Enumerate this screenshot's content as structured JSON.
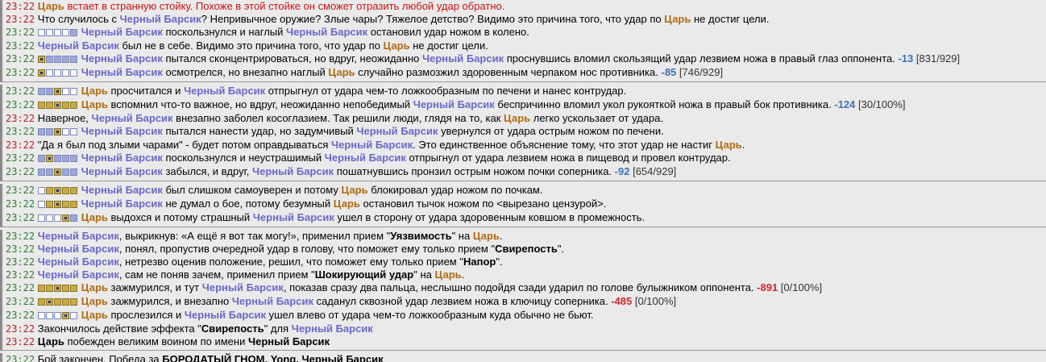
{
  "names": {
    "barsik": "Черный Барсик",
    "tsar": "Царь"
  },
  "time": "23:22",
  "lines": [
    {
      "group": 1,
      "time_red": true,
      "red": true,
      "parts": [
        [
          "c",
          "Царь"
        ],
        [
          "t",
          " встает в странную стойку. Похоже в этой стойке он сможет отразить любой удар обратно."
        ]
      ]
    },
    {
      "group": 1,
      "time_red": true,
      "parts": [
        [
          "t",
          "Что случилось с "
        ],
        [
          "b",
          "Черный Барсик"
        ],
        [
          "t",
          "? Непривычное оружие? Злые чары? Тяжелое детство? Видимо это причина того, что удар по "
        ],
        [
          "c",
          "Царь"
        ],
        [
          "t",
          " не достиг цели."
        ]
      ]
    },
    {
      "group": 1,
      "zones": "wwwwf",
      "parts": [
        [
          "b",
          "Черный Барсик"
        ],
        [
          "t",
          " поскользнулся и наглый "
        ],
        [
          "b",
          "Черный Барсик"
        ],
        [
          "t",
          " остановил удар ножом в колено."
        ]
      ]
    },
    {
      "group": 1,
      "parts": [
        [
          "b",
          "Черный Барсик"
        ],
        [
          "t",
          " был не в себе. Видимо это причина того, что удар по "
        ],
        [
          "c",
          "Царь"
        ],
        [
          "t",
          " не достиг цели."
        ]
      ]
    },
    {
      "group": 1,
      "wrap": true,
      "zones": "xffff",
      "parts": [
        [
          "b",
          "Черный Барсик"
        ],
        [
          "t",
          " пытался сконцентрироваться, но вдруг, неожиданно "
        ],
        [
          "b",
          "Черный Барсик"
        ],
        [
          "t",
          " проснувшись вломил скользящий удар лезвием ножа в правый глаз оппонента. "
        ],
        [
          "dmgb",
          "-13"
        ],
        [
          "s",
          " [831/929]"
        ]
      ]
    },
    {
      "group": 1,
      "zones": "xwwww",
      "parts": [
        [
          "b",
          "Черный Барсик"
        ],
        [
          "t",
          " осмотрелся, но внезапно наглый "
        ],
        [
          "c",
          "Царь"
        ],
        [
          "t",
          " случайно размозжил здоровенным черпаком нос противника. "
        ],
        [
          "dmgb",
          "-85"
        ],
        [
          "s",
          " [746/929]"
        ]
      ]
    },
    {
      "group": 2,
      "zones": "ffxww",
      "parts": [
        [
          "c",
          "Царь"
        ],
        [
          "t",
          " просчитался и "
        ],
        [
          "b",
          "Черный Барсик"
        ],
        [
          "t",
          " отпрыгнул от удара чем-то ложкообразным по печени и нанес контрудар."
        ]
      ]
    },
    {
      "group": 2,
      "zones": "ppxpp",
      "parts": [
        [
          "c",
          "Царь"
        ],
        [
          "t",
          " вспомнил что-то важное, но вдруг, неожиданно непобедимый "
        ],
        [
          "b",
          "Черный Барсик"
        ],
        [
          "t",
          " беспричинно вломил укол рукояткой ножа в правый бок противника. "
        ],
        [
          "dmgb",
          "-124"
        ],
        [
          "s",
          " [30/100%]"
        ]
      ]
    },
    {
      "group": 2,
      "time_red": true,
      "parts": [
        [
          "t",
          "Наверное, "
        ],
        [
          "b",
          "Черный Барсик"
        ],
        [
          "t",
          " внезапно заболел косоглазием. Так решили люди, глядя на то, как "
        ],
        [
          "c",
          "Царь"
        ],
        [
          "t",
          " легко ускользает от удара."
        ]
      ]
    },
    {
      "group": 2,
      "zones": "ffxww",
      "parts": [
        [
          "b",
          "Черный Барсик"
        ],
        [
          "t",
          " пытался нанести удар, но задумчивый "
        ],
        [
          "b",
          "Черный Барсик"
        ],
        [
          "t",
          " увернулся от удара острым ножом по печени."
        ]
      ]
    },
    {
      "group": 2,
      "time_red": true,
      "parts": [
        [
          "t",
          "\"Да я был под злыми чарами\" - будет потом оправдываться "
        ],
        [
          "b",
          "Черный Барсик"
        ],
        [
          "t",
          ". Это единственное объяснение тому, что этот удар не настиг "
        ],
        [
          "c",
          "Царь"
        ],
        [
          "t",
          "."
        ]
      ]
    },
    {
      "group": 2,
      "zones": "fxfff",
      "parts": [
        [
          "b",
          "Черный Барсик"
        ],
        [
          "t",
          " поскользнулся и неустрашимый "
        ],
        [
          "b",
          "Черный Барсик"
        ],
        [
          "t",
          " отпрыгнул от удара лезвием ножа в пищевод и провел контрудар."
        ]
      ]
    },
    {
      "group": 2,
      "zones": "ffxff",
      "parts": [
        [
          "b",
          "Черный Барсик"
        ],
        [
          "t",
          " забылся, и вдруг, "
        ],
        [
          "b",
          "Черный Барсик"
        ],
        [
          "t",
          " пошатнувшись пронзил острым ножом почки соперника. "
        ],
        [
          "dmgb",
          "-92"
        ],
        [
          "s",
          " [654/929]"
        ]
      ]
    },
    {
      "group": 3,
      "zones": "wpxpp",
      "parts": [
        [
          "b",
          "Черный Барсик"
        ],
        [
          "t",
          " был слишком самоуверен и потому "
        ],
        [
          "c",
          "Царь"
        ],
        [
          "t",
          " блокировал удар ножом по почкам."
        ]
      ]
    },
    {
      "group": 3,
      "zones": "wpxpp",
      "parts": [
        [
          "b",
          "Черный Барсик"
        ],
        [
          "t",
          " не думал о бое, потому безумный "
        ],
        [
          "c",
          "Царь"
        ],
        [
          "t",
          " остановил тычок ножом по <вырезано цензурой>."
        ]
      ]
    },
    {
      "group": 3,
      "zones": "wwwxf",
      "parts": [
        [
          "c",
          "Царь"
        ],
        [
          "t",
          " выдохся и потому страшный "
        ],
        [
          "b",
          "Черный Барсик"
        ],
        [
          "t",
          " ушел в сторону от удара здоровенным ковшом в промежность."
        ]
      ]
    },
    {
      "group": 4,
      "parts": [
        [
          "b",
          "Черный Барсик"
        ],
        [
          "t",
          ", выкрикнув: «А ещё я вот так могу!», применил прием \""
        ],
        [
          "k",
          "Уязвимость"
        ],
        [
          "t",
          "\" на "
        ],
        [
          "c",
          "Царь"
        ],
        [
          "t",
          "."
        ]
      ]
    },
    {
      "group": 4,
      "parts": [
        [
          "b",
          "Черный Барсик"
        ],
        [
          "t",
          ", понял, пропустив очередной удар в голову, что поможет ему только прием \""
        ],
        [
          "k",
          "Свирепость"
        ],
        [
          "t",
          "\"."
        ]
      ]
    },
    {
      "group": 4,
      "parts": [
        [
          "b",
          "Черный Барсик"
        ],
        [
          "t",
          ", нетрезво оценив положение, решил, что поможет ему только прием \""
        ],
        [
          "k",
          "Напор"
        ],
        [
          "t",
          "\"."
        ]
      ]
    },
    {
      "group": 4,
      "parts": [
        [
          "b",
          "Черный Барсик"
        ],
        [
          "t",
          ", сам не поняв зачем, применил прием \""
        ],
        [
          "k",
          "Шокирующий удар"
        ],
        [
          "t",
          "\" на "
        ],
        [
          "c",
          "Царь"
        ],
        [
          "t",
          "."
        ]
      ]
    },
    {
      "group": 4,
      "zones": "ppxpp",
      "parts": [
        [
          "c",
          "Царь"
        ],
        [
          "t",
          " зажмурился, и тут "
        ],
        [
          "b",
          "Черный Барсик"
        ],
        [
          "t",
          ", показав сразу два пальца, неслышно подойдя сзади ударил по голове булыжником оппонента. "
        ],
        [
          "dmgr",
          "-891"
        ],
        [
          "s",
          " [0/100%]"
        ]
      ]
    },
    {
      "group": 4,
      "zones": "pxppp",
      "parts": [
        [
          "c",
          "Царь"
        ],
        [
          "t",
          " зажмурился, и внезапно "
        ],
        [
          "b",
          "Черный Барсик"
        ],
        [
          "t",
          " саданул сквозной удар лезвием ножа в ключицу соперника. "
        ],
        [
          "dmgr",
          "-485"
        ],
        [
          "s",
          " [0/100%]"
        ]
      ]
    },
    {
      "group": 4,
      "zones": "wwwxw",
      "parts": [
        [
          "c",
          "Царь"
        ],
        [
          "t",
          " прослезился и "
        ],
        [
          "b",
          "Черный Барсик"
        ],
        [
          "t",
          " ушел влево от удара чем-то ложкообразным куда обычно не бьют."
        ]
      ]
    },
    {
      "group": 4,
      "time_red": true,
      "parts": [
        [
          "t",
          "Закончилось действие эффекта \""
        ],
        [
          "k",
          "Свирепость"
        ],
        [
          "t",
          "\" для "
        ],
        [
          "b",
          "Черный Барсик"
        ]
      ]
    },
    {
      "group": 4,
      "time_red": true,
      "parts": [
        [
          "k",
          "Царь"
        ],
        [
          "t",
          " побежден великим воином по имени "
        ],
        [
          "k",
          "Черный Барсик"
        ]
      ]
    },
    {
      "group": 5,
      "parts": [
        [
          "t",
          "Бой закончен. Победа за "
        ],
        [
          "k",
          "БОРОДАТЫЙ ГНОМ, Yong, Черный Барсик"
        ]
      ]
    }
  ]
}
